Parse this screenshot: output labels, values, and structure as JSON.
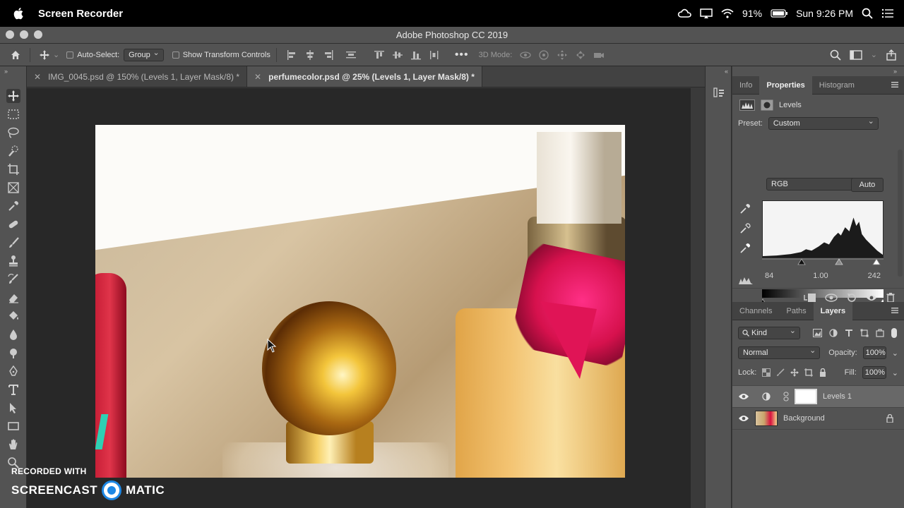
{
  "menubar": {
    "app_name": "Screen Recorder",
    "battery": "91%",
    "clock": "Sun 9:26 PM"
  },
  "window": {
    "title": "Adobe Photoshop CC 2019"
  },
  "options_bar": {
    "auto_select_label": "Auto-Select:",
    "auto_select_value": "Group",
    "transform_controls_label": "Show Transform Controls",
    "mode_3d_label": "3D Mode:"
  },
  "document_tabs": [
    {
      "label": "IMG_0045.psd @ 150% (Levels 1, Layer Mask/8) *",
      "active": false
    },
    {
      "label": "perfumecolor.psd @ 25% (Levels 1, Layer Mask/8) *",
      "active": true
    }
  ],
  "properties_panel": {
    "tabs": [
      "Info",
      "Properties",
      "Histogram"
    ],
    "active_tab": "Properties",
    "adjustment_name": "Levels",
    "preset_label": "Preset:",
    "preset_value": "Custom",
    "channel_value": "RGB",
    "auto_label": "Auto",
    "input_black": "84",
    "input_gamma": "1.00",
    "input_white": "242"
  },
  "layers_panel": {
    "tabs": [
      "Channels",
      "Paths",
      "Layers"
    ],
    "active_tab": "Layers",
    "filter_value": "Kind",
    "blend_mode": "Normal",
    "opacity_label": "Opacity:",
    "opacity_value": "100%",
    "lock_label": "Lock:",
    "fill_label": "Fill:",
    "fill_value": "100%",
    "layers": [
      {
        "name": "Levels 1",
        "selected": true
      },
      {
        "name": "Background",
        "selected": false,
        "locked": true
      }
    ]
  },
  "watermark": {
    "line1": "RECORDED WITH",
    "line2_a": "SCREENCAST",
    "line2_b": "MATIC"
  },
  "colors": {
    "ui_panel": "#535353",
    "canvas_bg": "#282828",
    "accent_blue": "#1e88e5"
  }
}
